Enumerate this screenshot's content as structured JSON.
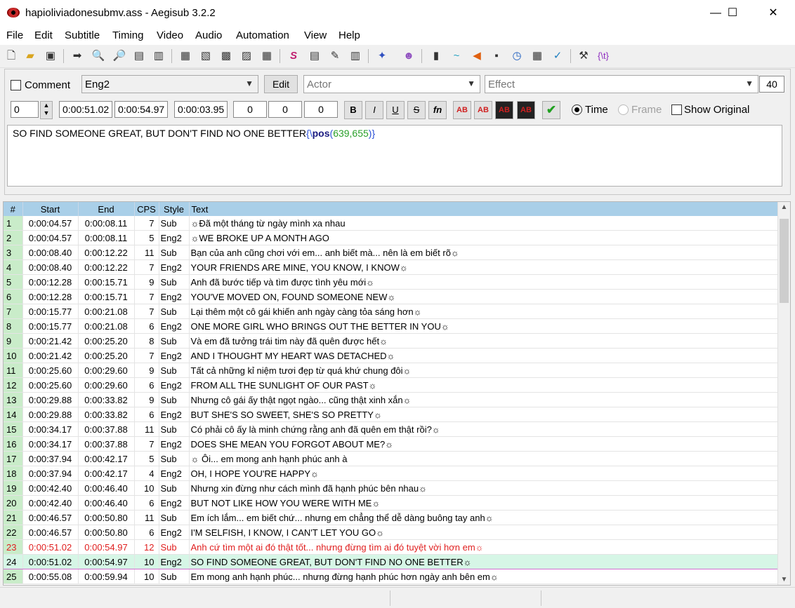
{
  "window": {
    "title": "hapioliviadonesubmv.ass - Aegisub 3.2.2",
    "minimize": "—",
    "maximize": "☐",
    "close": "✕"
  },
  "menu": [
    "File",
    "Edit",
    "Subtitle",
    "Timing",
    "Video",
    "Audio",
    "Automation",
    "View",
    "Help"
  ],
  "toolbar_icons": [
    "new-file-icon",
    "open-folder-icon",
    "save-icon",
    "jump-icon",
    "zoom-in-icon",
    "zoom-out-icon",
    "video-detach-icon",
    "video-toggle-icon",
    "styles-icon",
    "properties-icon",
    "attachments-icon",
    "fonts-icon",
    "automation-icon",
    "styles-manager-icon",
    "translation-icon",
    "resample-icon",
    "spellcheck-icon",
    "kanji-timer-icon",
    "timing-post-icon",
    "shift-times-icon",
    "audio-icon",
    "fish-icon",
    "stop-icon",
    "clock-icon",
    "visual-icon",
    "check-icon",
    "tools-icon",
    "tag-icon"
  ],
  "edit": {
    "comment_label": "Comment",
    "style_value": "Eng2",
    "edit_button": "Edit",
    "actor_placeholder": "Actor",
    "effect_placeholder": "Effect",
    "char_count": "40",
    "layer": "0",
    "start_time": "0:00:51.02",
    "end_time": "0:00:54.97",
    "duration": "0:00:03.95",
    "margin_left": "0",
    "margin_right": "0",
    "margin_vert": "0",
    "bold": "B",
    "italic": "I",
    "underline": "U",
    "strike": "S",
    "fn": "fn",
    "color_labels": [
      "AB",
      "AB",
      "AB",
      "AB"
    ],
    "commit": "✔",
    "time_label": "Time",
    "frame_label": "Frame",
    "show_original_label": "Show Original",
    "text_plain": "SO FIND SOMEONE GREAT, BUT DON'T FIND NO ONE BETTER",
    "tag_open": "{",
    "tag_backslash": "\\",
    "tag_name": "pos",
    "tag_args_open": "(",
    "tag_args": "639,655",
    "tag_args_close": ")",
    "tag_close": "}",
    "colors": {
      "tag_brace": "#2a4fd6",
      "tag_name": "#1a1a80",
      "tag_args": "#2aa02a"
    }
  },
  "grid": {
    "columns": [
      "#",
      "Start",
      "End",
      "CPS",
      "Style",
      "Text"
    ],
    "rows": [
      {
        "n": "1",
        "start": "0:00:04.57",
        "end": "0:00:08.11",
        "cps": "7",
        "style": "Sub",
        "text": "☼Đã một tháng từ ngày mình xa nhau"
      },
      {
        "n": "2",
        "start": "0:00:04.57",
        "end": "0:00:08.11",
        "cps": "5",
        "style": "Eng2",
        "text": "☼WE BROKE UP A MONTH AGO"
      },
      {
        "n": "3",
        "start": "0:00:08.40",
        "end": "0:00:12.22",
        "cps": "11",
        "style": "Sub",
        "text": "Bạn của anh cũng chơi với em... anh biết mà... nên là em biết rõ☼"
      },
      {
        "n": "4",
        "start": "0:00:08.40",
        "end": "0:00:12.22",
        "cps": "7",
        "style": "Eng2",
        "text": "YOUR FRIENDS ARE MINE, YOU KNOW, I KNOW☼"
      },
      {
        "n": "5",
        "start": "0:00:12.28",
        "end": "0:00:15.71",
        "cps": "9",
        "style": "Sub",
        "text": "Anh đã bước tiếp và tìm được tình yêu mới☼"
      },
      {
        "n": "6",
        "start": "0:00:12.28",
        "end": "0:00:15.71",
        "cps": "7",
        "style": "Eng2",
        "text": "YOU'VE MOVED ON, FOUND SOMEONE NEW☼"
      },
      {
        "n": "7",
        "start": "0:00:15.77",
        "end": "0:00:21.08",
        "cps": "7",
        "style": "Sub",
        "text": "Lại thêm một cô gái khiến anh ngày càng tỏa sáng hơn☼"
      },
      {
        "n": "8",
        "start": "0:00:15.77",
        "end": "0:00:21.08",
        "cps": "6",
        "style": "Eng2",
        "text": "ONE MORE GIRL WHO BRINGS OUT THE BETTER IN YOU☼"
      },
      {
        "n": "9",
        "start": "0:00:21.42",
        "end": "0:00:25.20",
        "cps": "8",
        "style": "Sub",
        "text": "Và em đã tưởng trái tim này đã quên được hết☼"
      },
      {
        "n": "10",
        "start": "0:00:21.42",
        "end": "0:00:25.20",
        "cps": "7",
        "style": "Eng2",
        "text": "AND I THOUGHT MY HEART WAS DETACHED☼"
      },
      {
        "n": "11",
        "start": "0:00:25.60",
        "end": "0:00:29.60",
        "cps": "9",
        "style": "Sub",
        "text": "Tất cả những kỉ niệm tươi đẹp từ quá khứ chung đôi☼"
      },
      {
        "n": "12",
        "start": "0:00:25.60",
        "end": "0:00:29.60",
        "cps": "6",
        "style": "Eng2",
        "text": "FROM ALL THE SUNLIGHT OF OUR PAST☼"
      },
      {
        "n": "13",
        "start": "0:00:29.88",
        "end": "0:00:33.82",
        "cps": "9",
        "style": "Sub",
        "text": "Nhưng cô gái ấy thật ngọt ngào... cũng thật xinh xắn☼"
      },
      {
        "n": "14",
        "start": "0:00:29.88",
        "end": "0:00:33.82",
        "cps": "6",
        "style": "Eng2",
        "text": "BUT SHE'S SO SWEET, SHE'S SO PRETTY☼"
      },
      {
        "n": "15",
        "start": "0:00:34.17",
        "end": "0:00:37.88",
        "cps": "11",
        "style": "Sub",
        "text": "Có phải cô ấy là minh chứng rằng anh đã quên em thật rồi?☼"
      },
      {
        "n": "16",
        "start": "0:00:34.17",
        "end": "0:00:37.88",
        "cps": "7",
        "style": "Eng2",
        "text": "DOES SHE MEAN YOU FORGOT ABOUT ME?☼"
      },
      {
        "n": "17",
        "start": "0:00:37.94",
        "end": "0:00:42.17",
        "cps": "5",
        "style": "Sub",
        "text": "☼ Ôi... em mong anh hạnh phúc anh à"
      },
      {
        "n": "18",
        "start": "0:00:37.94",
        "end": "0:00:42.17",
        "cps": "4",
        "style": "Eng2",
        "text": "OH, I HOPE YOU'RE HAPPY☼"
      },
      {
        "n": "19",
        "start": "0:00:42.40",
        "end": "0:00:46.40",
        "cps": "10",
        "style": "Sub",
        "text": "Nhưng xin đừng như cách mình đã hạnh phúc bên nhau☼"
      },
      {
        "n": "20",
        "start": "0:00:42.40",
        "end": "0:00:46.40",
        "cps": "6",
        "style": "Eng2",
        "text": "BUT NOT LIKE HOW YOU WERE WITH ME☼"
      },
      {
        "n": "21",
        "start": "0:00:46.57",
        "end": "0:00:50.80",
        "cps": "11",
        "style": "Sub",
        "text": "Em ích lắm... em biết chứ... nhưng em chẳng thể dễ dàng buông tay anh☼"
      },
      {
        "n": "22",
        "start": "0:00:46.57",
        "end": "0:00:50.80",
        "cps": "6",
        "style": "Eng2",
        "text": "I'M SELFISH, I KNOW, I CAN'T LET YOU GO☼"
      },
      {
        "n": "23",
        "start": "0:00:51.02",
        "end": "0:00:54.97",
        "cps": "12",
        "style": "Sub",
        "text": "Anh cứ tìm một ai đó thật tốt... nhưng đừng tìm ai đó tuyệt vời hơn em☼",
        "state": "red"
      },
      {
        "n": "24",
        "start": "0:00:51.02",
        "end": "0:00:54.97",
        "cps": "10",
        "style": "Eng2",
        "text": "SO FIND SOMEONE GREAT, BUT DON'T FIND NO ONE BETTER☼",
        "state": "active"
      },
      {
        "n": "25",
        "start": "0:00:55.08",
        "end": "0:00:59.94",
        "cps": "10",
        "style": "Sub",
        "text": "Em mong anh hạnh phúc... nhưng đừng hạnh phúc hơn ngày anh bên em☼"
      }
    ]
  }
}
